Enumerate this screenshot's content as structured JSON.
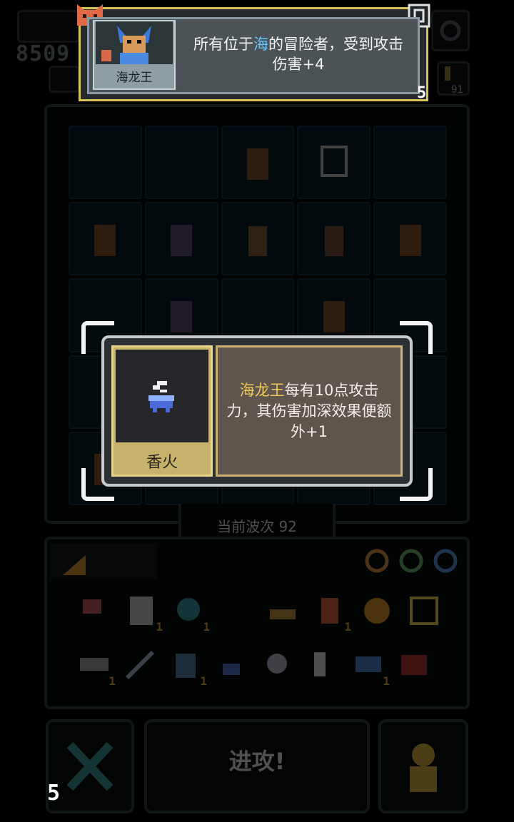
{
  "hud": {
    "score": "8509",
    "wave_count": "91"
  },
  "hero_card": {
    "name": "海龙王",
    "desc_before": "所有位于",
    "desc_highlight": "海",
    "desc_after": "的冒险者，受到攻击伤害+4",
    "badge": "5"
  },
  "board": {
    "wave_label": "当前波次 92"
  },
  "inventory": {
    "row1": [
      {
        "icon": "axe-icon",
        "count": ""
      },
      {
        "icon": "scroll-icon",
        "count": "1"
      },
      {
        "icon": "heart-gem-icon",
        "count": "1"
      },
      {
        "icon": "ship-icon",
        "count": ""
      },
      {
        "icon": "warrior-icon",
        "count": "1"
      },
      {
        "icon": "gear-coin-icon",
        "count": ""
      },
      {
        "icon": "wings-icon",
        "count": ""
      }
    ],
    "row2": [
      {
        "icon": "anvil-icon",
        "count": "1"
      },
      {
        "icon": "sword-icon",
        "count": ""
      },
      {
        "icon": "pagoda-icon",
        "count": "1"
      },
      {
        "icon": "incense-icon",
        "count": ""
      },
      {
        "icon": "skull-icon",
        "count": ""
      },
      {
        "icon": "boot-icon",
        "count": ""
      },
      {
        "icon": "fish-icon",
        "count": "1"
      },
      {
        "icon": "chest-icon",
        "count": ""
      }
    ]
  },
  "actions": {
    "attack_label": "进攻!",
    "turns_left": "5"
  },
  "modal": {
    "item_name": "香火",
    "desc_highlight": "海龙王",
    "desc_rest": "每有10点攻击力，其伤害加深效果便额外+1"
  },
  "colors": {
    "gold": "#f0c85a",
    "sea_blue": "#67c6ff",
    "card_border": "#d8c35a"
  }
}
